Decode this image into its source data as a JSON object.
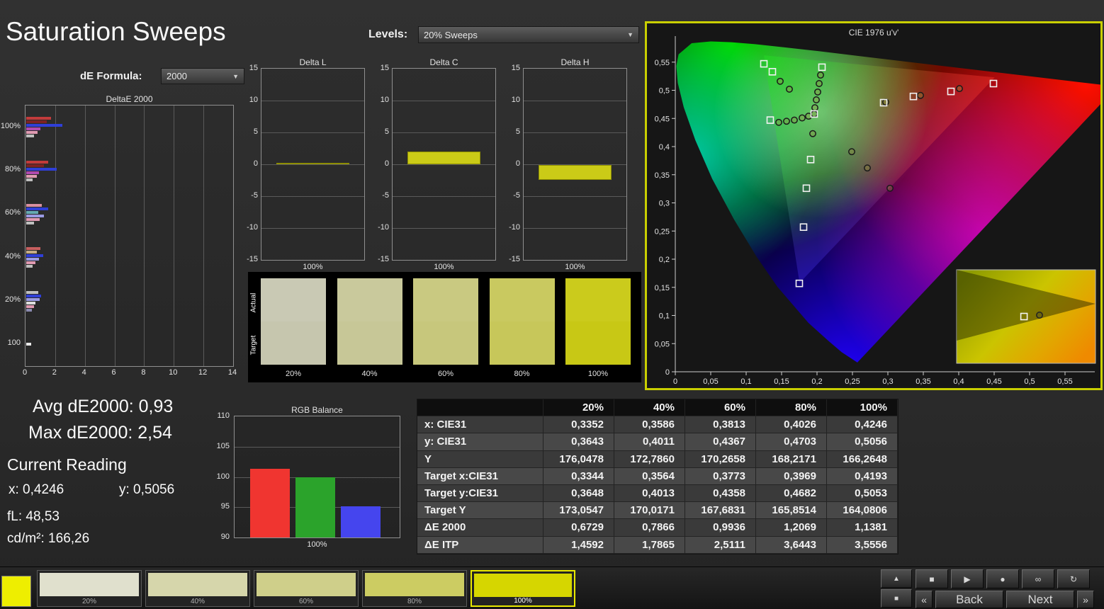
{
  "app": {
    "title": "Saturation Sweeps"
  },
  "header": {
    "levels_label": "Levels:",
    "levels_value": "20% Sweeps",
    "de_formula_label": "dE Formula:",
    "de_formula_value": "2000"
  },
  "deltae_chart": {
    "title": "DeltaE 2000",
    "x_ticks": [
      0,
      2,
      4,
      6,
      8,
      10,
      12,
      14
    ],
    "x_max": 14,
    "groups": [
      {
        "label": "100%",
        "bars": [
          {
            "color": "#c23b3b",
            "value": 1.65
          },
          {
            "color": "#7c2222",
            "value": 1.4
          },
          {
            "color": "#2f3fd8",
            "value": 2.45
          },
          {
            "color": "#b04ab0",
            "value": 0.95
          },
          {
            "color": "#e09ab2",
            "value": 0.75
          },
          {
            "color": "#bfbfbf",
            "value": 0.5
          }
        ]
      },
      {
        "label": "80%",
        "bars": [
          {
            "color": "#c23b3b",
            "value": 1.5
          },
          {
            "color": "#7c2222",
            "value": 1.2
          },
          {
            "color": "#2f3fd8",
            "value": 2.05
          },
          {
            "color": "#b04ab0",
            "value": 0.85
          },
          {
            "color": "#e09ab2",
            "value": 0.7
          },
          {
            "color": "#bfbfbf",
            "value": 0.45
          }
        ]
      },
      {
        "label": "60%",
        "bars": [
          {
            "color": "#d88f9f",
            "value": 1.05
          },
          {
            "color": "#2f3fd8",
            "value": 1.5
          },
          {
            "color": "#64aab2",
            "value": 0.8
          },
          {
            "color": "#9a9ae2",
            "value": 1.2
          },
          {
            "color": "#e09ab2",
            "value": 0.9
          },
          {
            "color": "#bfbfbf",
            "value": 0.5
          }
        ]
      },
      {
        "label": "40%",
        "bars": [
          {
            "color": "#c75f5f",
            "value": 0.95
          },
          {
            "color": "#c4ab84",
            "value": 0.7
          },
          {
            "color": "#2f3fd8",
            "value": 1.15
          },
          {
            "color": "#9a9ae2",
            "value": 0.85
          },
          {
            "color": "#e09ab2",
            "value": 0.6
          },
          {
            "color": "#bfbfbf",
            "value": 0.45
          }
        ]
      },
      {
        "label": "20%",
        "bars": [
          {
            "color": "#bfbfbf",
            "value": 0.8
          },
          {
            "color": "#2f3fd8",
            "value": 1.0
          },
          {
            "color": "#9a9ae2",
            "value": 0.9
          },
          {
            "color": "#dddddd",
            "value": 0.6
          },
          {
            "color": "#e09ab2",
            "value": 0.5
          },
          {
            "color": "#8a8ab0",
            "value": 0.4
          }
        ]
      },
      {
        "label": "100",
        "bars": [
          {
            "color": "#e8e8e8",
            "value": 0.35
          }
        ]
      }
    ]
  },
  "delta_axis": {
    "ticks": [
      15,
      10,
      5,
      0,
      -5,
      -10,
      -15
    ],
    "min": -15,
    "max": 15
  },
  "delta_charts": [
    {
      "title": "Delta L",
      "x_label": "100%",
      "value": 0.1
    },
    {
      "title": "Delta C",
      "x_label": "100%",
      "value": 2.0
    },
    {
      "title": "Delta H",
      "x_label": "100%",
      "value": -2.3
    }
  ],
  "swatches": {
    "actual_label": "Actual",
    "target_label": "Target",
    "items": [
      {
        "label": "20%",
        "actual": "#c9c9b4",
        "target": "#c6c6ae"
      },
      {
        "label": "40%",
        "actual": "#c9c99c",
        "target": "#c7c797"
      },
      {
        "label": "60%",
        "actual": "#c9c981",
        "target": "#c7c77c"
      },
      {
        "label": "80%",
        "actual": "#c9c960",
        "target": "#c7c75a"
      },
      {
        "label": "100%",
        "actual": "#cbcb1c",
        "target": "#c8c815"
      }
    ]
  },
  "stats": {
    "avg": "Avg dE2000: 0,93",
    "max": "Max dE2000: 2,54",
    "current_heading": "Current Reading",
    "x": "x: 0,4246",
    "y": "y: 0,5056",
    "fl": "fL: 48,53",
    "cd": "cd/m²: 166,26"
  },
  "rgb_balance": {
    "title": "RGB Balance",
    "y_ticks": [
      110,
      105,
      100,
      95,
      90
    ],
    "y_min": 90,
    "y_max": 110,
    "x_label": "100%",
    "bars": [
      {
        "name": "red",
        "color": "#f03530",
        "value": 101.4
      },
      {
        "name": "green",
        "color": "#2ba32b",
        "value": 100.0
      },
      {
        "name": "blue",
        "color": "#4545ee",
        "value": 95.2
      }
    ]
  },
  "table": {
    "columns": [
      "",
      "20%",
      "40%",
      "60%",
      "80%",
      "100%"
    ],
    "rows": [
      {
        "label": "x: CIE31",
        "values": [
          "0,3352",
          "0,3586",
          "0,3813",
          "0,4026",
          "0,4246"
        ]
      },
      {
        "label": "y: CIE31",
        "values": [
          "0,3643",
          "0,4011",
          "0,4367",
          "0,4703",
          "0,5056"
        ]
      },
      {
        "label": "Y",
        "values": [
          "176,0478",
          "172,7860",
          "170,2658",
          "168,2171",
          "166,2648"
        ]
      },
      {
        "label": "Target x:CIE31",
        "values": [
          "0,3344",
          "0,3564",
          "0,3773",
          "0,3969",
          "0,4193"
        ]
      },
      {
        "label": "Target y:CIE31",
        "values": [
          "0,3648",
          "0,4013",
          "0,4358",
          "0,4682",
          "0,5053"
        ]
      },
      {
        "label": "Target Y",
        "values": [
          "173,0547",
          "170,0171",
          "167,6831",
          "165,8514",
          "164,0806"
        ]
      },
      {
        "label": "ΔE 2000",
        "values": [
          "0,6729",
          "0,7866",
          "0,9936",
          "1,2069",
          "1,1381"
        ]
      },
      {
        "label": "ΔE ITP",
        "values": [
          "1,4592",
          "1,7865",
          "2,5111",
          "3,6443",
          "3,5556"
        ]
      }
    ]
  },
  "cie": {
    "title": "CIE 1976 u'v'",
    "x_ticks": [
      "0",
      "0,05",
      "0,1",
      "0,15",
      "0,2",
      "0,25",
      "0,3",
      "0,35",
      "0,4",
      "0,45",
      "0,5",
      "0,55"
    ],
    "y_ticks": [
      "0",
      "0,05",
      "0,1",
      "0,15",
      "0,2",
      "0,25",
      "0,3",
      "0,35",
      "0,4",
      "0,45",
      "0,5",
      "0,55"
    ],
    "targets": [
      [
        0.125,
        0.547
      ],
      [
        0.137,
        0.533
      ],
      [
        0.207,
        0.541
      ],
      [
        0.134,
        0.447
      ],
      [
        0.196,
        0.458
      ],
      [
        0.294,
        0.478
      ],
      [
        0.336,
        0.489
      ],
      [
        0.389,
        0.498
      ],
      [
        0.449,
        0.512
      ],
      [
        0.191,
        0.377
      ],
      [
        0.185,
        0.326
      ],
      [
        0.181,
        0.257
      ],
      [
        0.175,
        0.157
      ]
    ],
    "measurements": [
      [
        0.148,
        0.516
      ],
      [
        0.161,
        0.502
      ],
      [
        0.205,
        0.527
      ],
      [
        0.203,
        0.512
      ],
      [
        0.201,
        0.497
      ],
      [
        0.199,
        0.483
      ],
      [
        0.197,
        0.469
      ],
      [
        0.196,
        0.458
      ],
      [
        0.146,
        0.443
      ],
      [
        0.157,
        0.445
      ],
      [
        0.168,
        0.447
      ],
      [
        0.179,
        0.451
      ],
      [
        0.188,
        0.454
      ],
      [
        0.297,
        0.479
      ],
      [
        0.346,
        0.491
      ],
      [
        0.401,
        0.503
      ],
      [
        0.249,
        0.391
      ],
      [
        0.271,
        0.362
      ],
      [
        0.303,
        0.326
      ],
      [
        0.194,
        0.423
      ]
    ],
    "inset": {
      "square": [
        0.485,
        0.5
      ],
      "circle": [
        0.597,
        0.485
      ]
    }
  },
  "bottom_bar": {
    "current_color": "#eeee00",
    "patches": [
      {
        "label": "20%",
        "color": "#e0e0cd"
      },
      {
        "label": "40%",
        "color": "#d6d6ab"
      },
      {
        "label": "60%",
        "color": "#cfcf8a"
      },
      {
        "label": "80%",
        "color": "#cccc62"
      },
      {
        "label": "100%",
        "color": "#d6d600"
      }
    ],
    "selected_index": 4,
    "side_buttons": [
      {
        "name": "panel-up",
        "glyph": "▲"
      },
      {
        "name": "panel-frame",
        "glyph": "■"
      }
    ],
    "controls": [
      {
        "name": "stop",
        "glyph": "■"
      },
      {
        "name": "play",
        "glyph": "▶"
      },
      {
        "name": "record",
        "glyph": "●"
      },
      {
        "name": "loop",
        "glyph": "∞"
      },
      {
        "name": "refresh",
        "glyph": "↻"
      }
    ],
    "prev_icon": "«",
    "next_icon": "»",
    "back_label": "Back",
    "next_label": "Next"
  }
}
